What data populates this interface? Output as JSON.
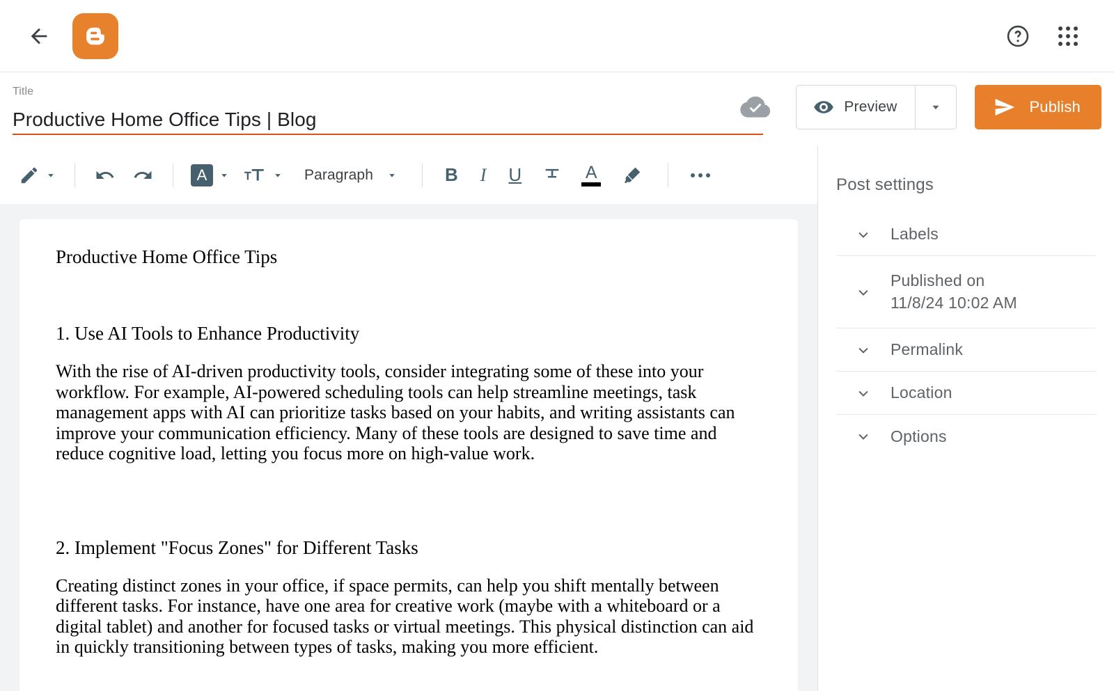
{
  "appbar": {
    "back_icon": "arrow-left-icon",
    "logo_icon": "blogger-logo-icon",
    "help_icon": "help-circle-icon",
    "apps_icon": "apps-grid-icon",
    "brand_color": "#e8812c"
  },
  "title_bar": {
    "label": "Title",
    "value": "Productive Home Office Tips | Blog",
    "placeholder": "Title",
    "underline_color": "#d9521b",
    "save_status_icon": "cloud-done-icon",
    "preview_label": "Preview",
    "preview_icon": "eye-icon",
    "preview_caret_icon": "chevron-down-icon",
    "publish_label": "Publish",
    "publish_icon": "send-icon",
    "publish_color": "#e8802b"
  },
  "toolbar": {
    "items": [
      {
        "name": "pen-icon",
        "label": ""
      },
      {
        "name": "undo-icon",
        "label": ""
      },
      {
        "name": "redo-icon",
        "label": ""
      },
      {
        "name": "font-family-icon",
        "label": "A"
      },
      {
        "name": "font-size-icon",
        "label": ""
      },
      {
        "name": "paragraph-style",
        "label": "Paragraph"
      },
      {
        "name": "bold-icon",
        "label": "B"
      },
      {
        "name": "italic-icon",
        "label": "I"
      },
      {
        "name": "underline-icon",
        "label": "U"
      },
      {
        "name": "strikethrough-icon",
        "label": ""
      },
      {
        "name": "text-color-icon",
        "label": "A"
      },
      {
        "name": "highlight-icon",
        "label": ""
      },
      {
        "name": "more-options-icon",
        "label": ""
      }
    ],
    "paragraph_label": "Paragraph",
    "font_family_letter": "A",
    "bold_letter": "B",
    "italic_letter": "I",
    "underline_letter": "U",
    "text_color_letter": "A"
  },
  "document": {
    "heading": "Productive Home Office Tips",
    "sections": [
      {
        "heading": "1. Use AI Tools to Enhance Productivity",
        "body": "With the rise of AI-driven productivity tools, consider integrating some of these into your workflow. For example, AI-powered scheduling tools can help streamline meetings, task management apps with AI can prioritize tasks based on your habits, and writing assistants can improve your communication efficiency. Many of these tools are designed to save time and reduce cognitive load, letting you focus more on high-value work."
      },
      {
        "heading": "2. Implement \"Focus Zones\" for Different Tasks",
        "body": "Creating distinct zones in your office, if space permits, can help you shift mentally between different tasks. For instance, have one area for creative work (maybe with a whiteboard or a digital tablet) and another for focused tasks or virtual meetings. This physical distinction can aid in quickly transitioning between types of tasks, making you more efficient."
      }
    ]
  },
  "settings": {
    "title": "Post settings",
    "rows": [
      {
        "label": "Labels",
        "value": ""
      },
      {
        "label": "Published on",
        "value": "11/8/24 10:02 AM"
      },
      {
        "label": "Permalink",
        "value": ""
      },
      {
        "label": "Location",
        "value": ""
      },
      {
        "label": "Options",
        "value": ""
      }
    ]
  }
}
